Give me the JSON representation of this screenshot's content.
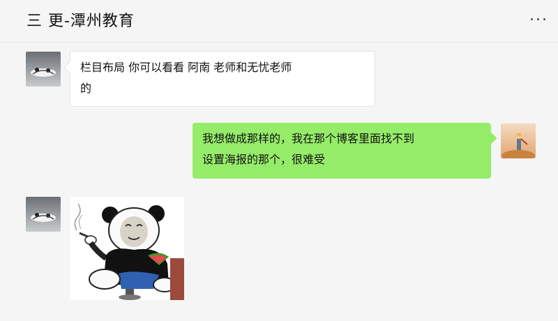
{
  "header": {
    "title": "三 更-潭州教育",
    "more_label": "..."
  },
  "messages": [
    {
      "side": "left",
      "sender_avatar": "panda-avatar-icon",
      "lines": [
        "栏目布局  你可以看看  阿南 老师和无忧老师",
        "的"
      ]
    },
    {
      "side": "right",
      "sender_avatar": "little-prince-avatar",
      "lines": [
        "我想做成那样的，我在那个博客里面找不到",
        "设置海报的那个，很难受"
      ]
    },
    {
      "side": "left",
      "sender_avatar": "panda-avatar-icon",
      "sticker": "panda-meme-smoking-watermelon-sticker"
    }
  ],
  "colors": {
    "background": "#f5f5f5",
    "right_bubble": "#95ec69",
    "left_bubble": "#ffffff"
  }
}
